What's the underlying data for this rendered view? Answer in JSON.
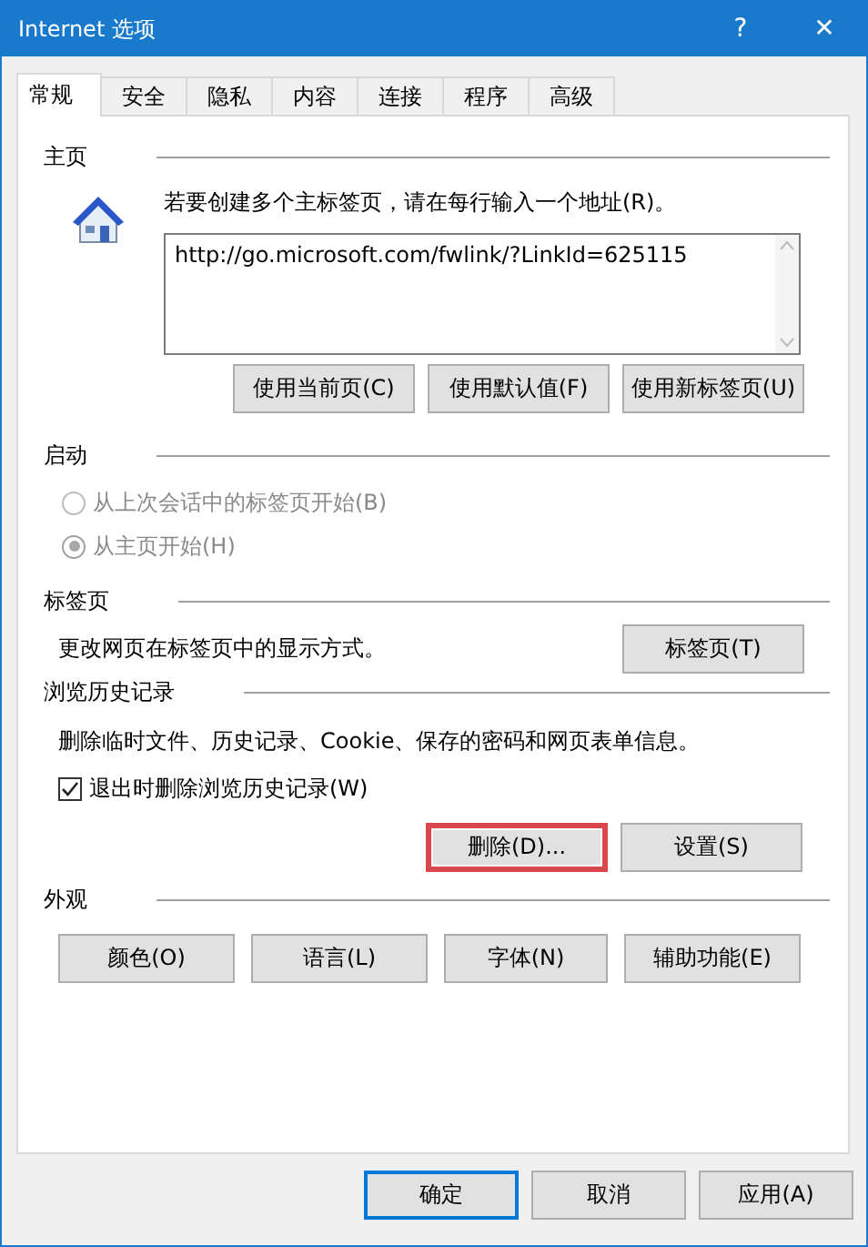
{
  "window": {
    "title": "Internet 选项",
    "help": "?",
    "close": "✕"
  },
  "tabs": [
    {
      "label": "常规",
      "selected": true
    },
    {
      "label": "安全",
      "selected": false
    },
    {
      "label": "隐私",
      "selected": false
    },
    {
      "label": "内容",
      "selected": false
    },
    {
      "label": "连接",
      "selected": false
    },
    {
      "label": "程序",
      "selected": false
    },
    {
      "label": "高级",
      "selected": false
    }
  ],
  "home": {
    "heading": "主页",
    "instruction": "若要创建多个主标签页，请在每行输入一个地址(R)。",
    "address": "http://go.microsoft.com/fwlink/?LinkId=625115",
    "buttons": [
      "使用当前页(C)",
      "使用默认值(F)",
      "使用新标签页(U)"
    ]
  },
  "startup": {
    "heading": "启动",
    "options": [
      {
        "label": "从上次会话中的标签页开始(B)",
        "selected": false,
        "disabled": true
      },
      {
        "label": "从主页开始(H)",
        "selected": true,
        "disabled": true
      }
    ]
  },
  "tabs_section": {
    "heading": "标签页",
    "text": "更改网页在标签页中的显示方式。",
    "button": "标签页(T)"
  },
  "history": {
    "heading": "浏览历史记录",
    "text": "删除临时文件、历史记录、Cookie、保存的密码和网页表单信息。",
    "checkbox": {
      "label": "退出时删除浏览历史记录(W)",
      "checked": true
    },
    "buttons": [
      {
        "label": "删除(D)...",
        "highlighted": true
      },
      {
        "label": "设置(S)",
        "highlighted": false
      }
    ]
  },
  "appearance": {
    "heading": "外观",
    "buttons": [
      "颜色(O)",
      "语言(L)",
      "字体(N)",
      "辅助功能(E)"
    ]
  },
  "footer": [
    {
      "label": "确定",
      "default": true
    },
    {
      "label": "取消",
      "default": false
    },
    {
      "label": "应用(A)",
      "default": false
    }
  ]
}
